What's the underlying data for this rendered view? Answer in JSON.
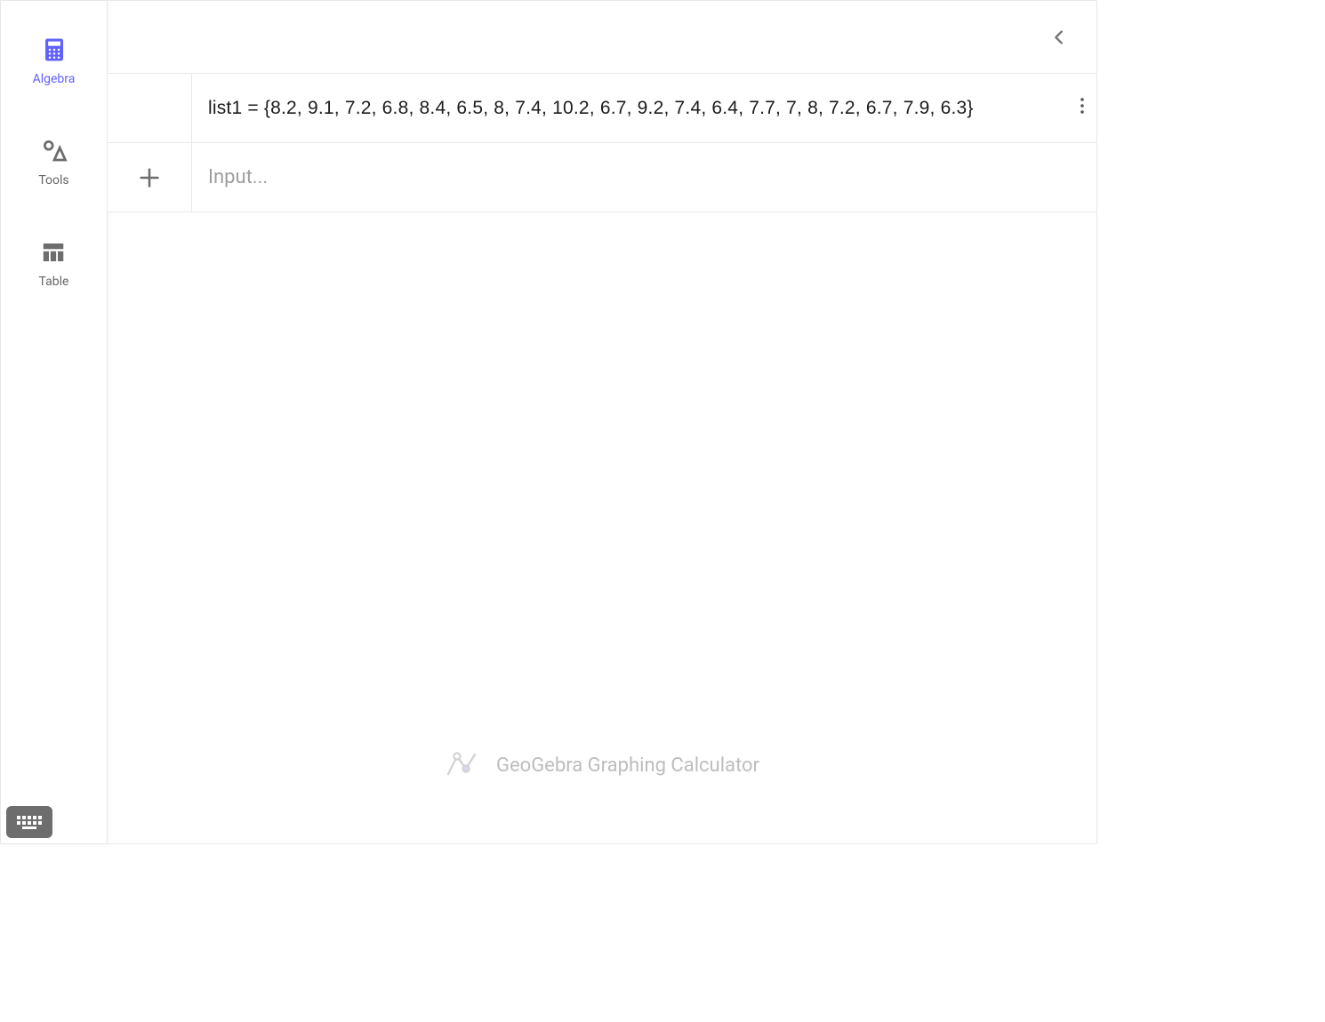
{
  "sidebar": {
    "items": [
      {
        "label": "Algebra",
        "active": true
      },
      {
        "label": "Tools",
        "active": false
      },
      {
        "label": "Table",
        "active": false
      }
    ]
  },
  "rows": [
    {
      "name": "list1",
      "expression": "list1 = {8.2, 9.1, 7.2, 6.8, 8.4, 6.5, 8, 7.4, 10.2, 6.7, 9.2, 7.4, 6.4, 7.7, 7, 8, 7.2, 6.7, 7.9, 6.3}",
      "values": [
        8.2,
        9.1,
        7.2,
        6.8,
        8.4,
        6.5,
        8,
        7.4,
        10.2,
        6.7,
        9.2,
        7.4,
        6.4,
        7.7,
        7,
        8,
        7.2,
        6.7,
        7.9,
        6.3
      ]
    }
  ],
  "input": {
    "placeholder": "Input..."
  },
  "watermark": "GeoGebra Graphing Calculator"
}
